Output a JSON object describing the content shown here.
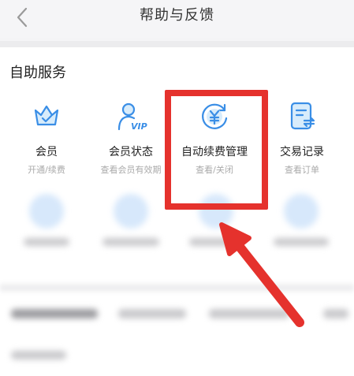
{
  "header": {
    "title": "帮助与反馈"
  },
  "section": {
    "title": "自助服务"
  },
  "services": [
    {
      "label": "会员",
      "sub": "开通/续费",
      "icon": "crown-icon"
    },
    {
      "label": "会员状态",
      "sub": "查看会员有效期",
      "icon": "person-vip-icon"
    },
    {
      "label": "自动续费管理",
      "sub": "查看/关闭",
      "icon": "yen-renew-icon"
    },
    {
      "label": "交易记录",
      "sub": "查看订单",
      "icon": "document-transfer-icon"
    }
  ],
  "colors": {
    "accent": "#3a8ee6",
    "icon_fill": "#d8ecfb",
    "annotation": "#e5322d"
  }
}
